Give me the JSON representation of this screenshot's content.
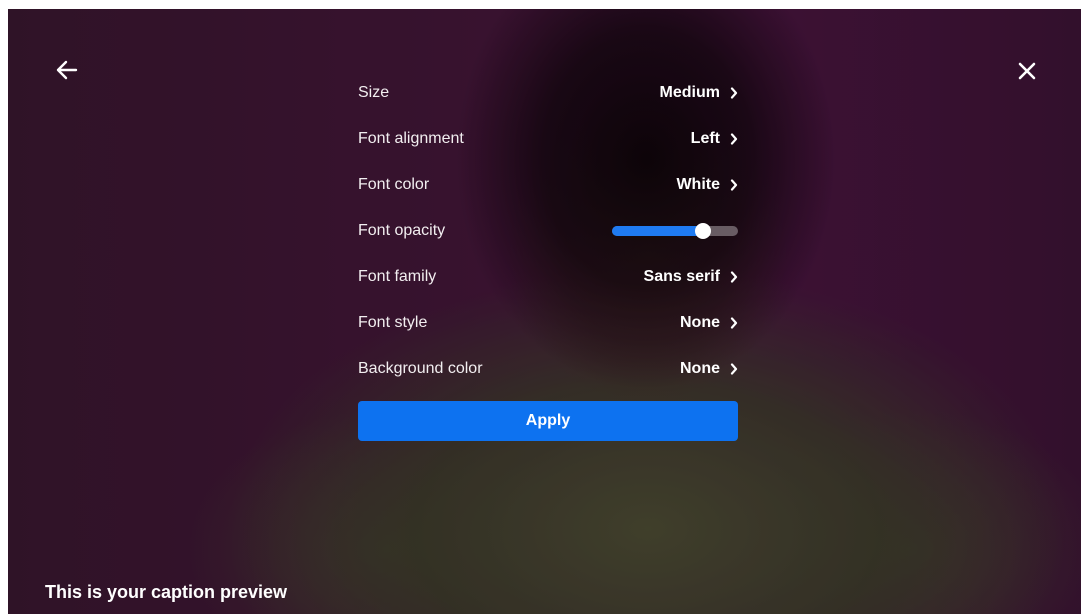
{
  "header": {
    "back_icon": "arrow-left-icon",
    "close_icon": "close-icon"
  },
  "settings": {
    "size": {
      "label": "Size",
      "value": "Medium"
    },
    "font_alignment": {
      "label": "Font alignment",
      "value": "Left"
    },
    "font_color": {
      "label": "Font color",
      "value": "White"
    },
    "font_opacity": {
      "label": "Font opacity",
      "level": 0.72
    },
    "font_family": {
      "label": "Font family",
      "value": "Sans serif"
    },
    "font_style": {
      "label": "Font style",
      "value": "None"
    },
    "background_color": {
      "label": "Background color",
      "value": "None"
    }
  },
  "apply_label": "Apply",
  "caption_preview": "This is your caption preview",
  "colors": {
    "accent": "#0d72f0",
    "slider_fill": "#1f7bf2",
    "text": "#ffffff"
  }
}
